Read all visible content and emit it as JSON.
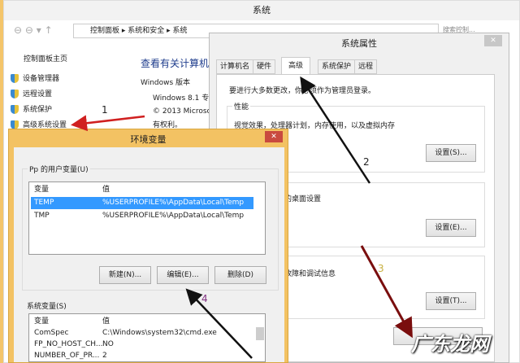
{
  "main": {
    "title": "系统",
    "breadcrumb": [
      "控制面板",
      "系统和安全",
      "系统"
    ],
    "search_placeholder": "搜索控制...",
    "home": "控制面板主页",
    "links": [
      "设备管理器",
      "远程设置",
      "系统保护",
      "高级系统设置"
    ],
    "heading": "查看有关计算机",
    "win_edition": "Windows 版本",
    "win_name": "Windows 8.1 专",
    "copyright": "© 2013 Microso",
    "rights": "有权利。"
  },
  "sysprops": {
    "title": "系统属性",
    "tabs": [
      "计算机名",
      "硬件",
      "高级",
      "系统保护",
      "远程"
    ],
    "note": "要进行大多数更改，你必须作为管理员登录。",
    "perf_label": "性能",
    "perf_desc": "视觉效果，处理器计划，内存使用，以及虚拟内存",
    "perf_btn": "设置(S)...",
    "profile_desc": "的桌面设置",
    "profile_btn": "设置(E)...",
    "startup_desc": "故障和调试信息",
    "startup_btn": "设置(T)..."
  },
  "envvars": {
    "title": "环境变量",
    "user_label": "Pp 的用户变量(U)",
    "col_var": "变量",
    "col_val": "值",
    "user_rows": [
      {
        "var": "TEMP",
        "val": "%USERPROFILE%\\AppData\\Local\\Temp"
      },
      {
        "var": "TMP",
        "val": "%USERPROFILE%\\AppData\\Local\\Temp"
      }
    ],
    "new_btn": "新建(N)...",
    "edit_btn": "编辑(E)...",
    "delete_btn": "删除(D)",
    "sys_label": "系统变量(S)",
    "sys_rows": [
      {
        "var": "ComSpec",
        "val": "C:\\Windows\\system32\\cmd.exe"
      },
      {
        "var": "FP_NO_HOST_CH...",
        "val": "NO"
      },
      {
        "var": "NUMBER_OF_PR...",
        "val": "2"
      }
    ]
  },
  "annotations": {
    "n1": "1",
    "n2": "2",
    "n3": "3",
    "n4": "4"
  },
  "watermark": "广东龙网"
}
